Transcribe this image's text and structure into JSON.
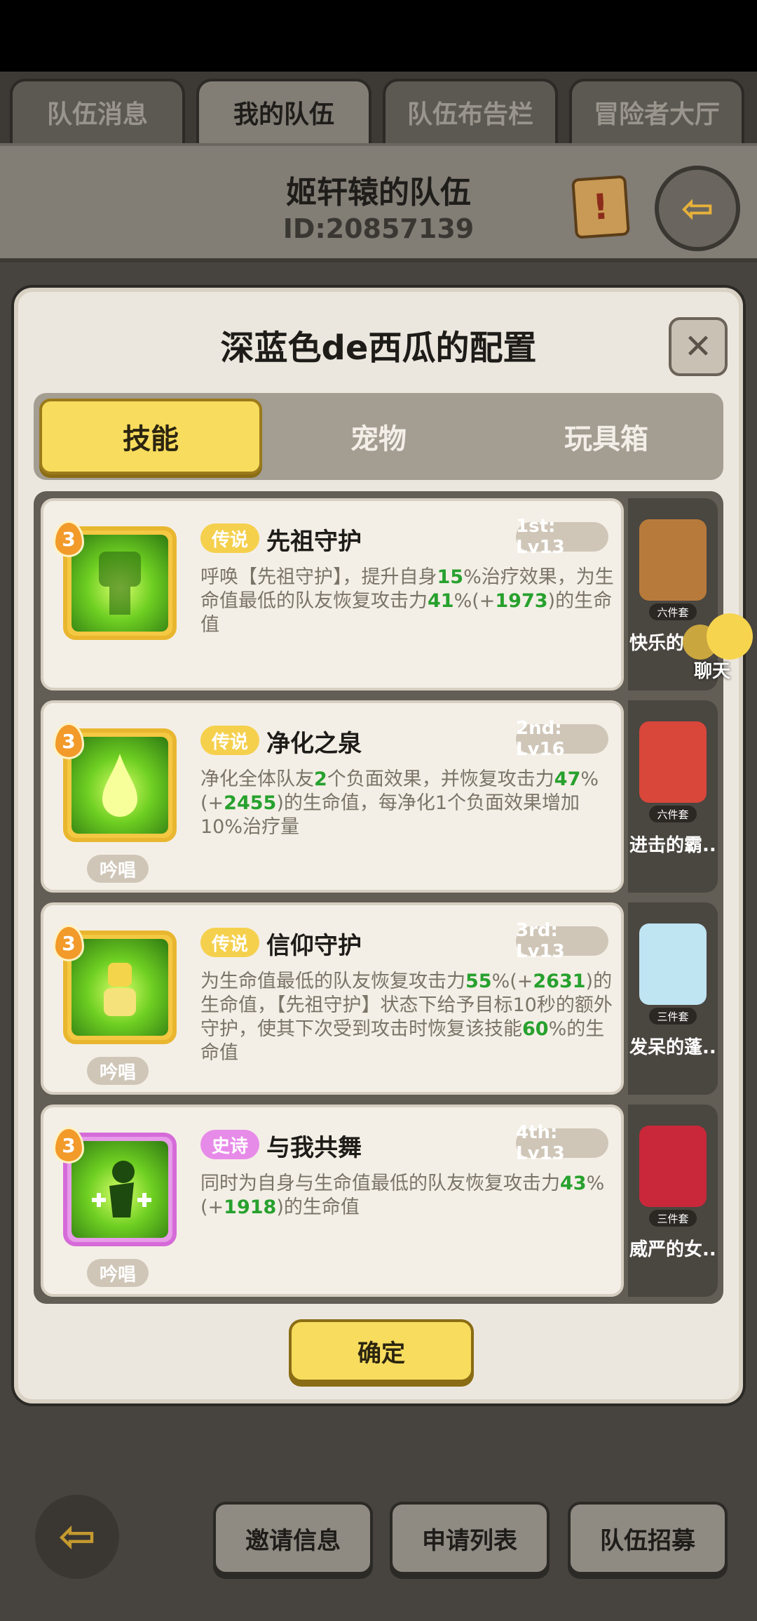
{
  "tabs": [
    "队伍消息",
    "我的队伍",
    "队伍布告栏",
    "冒险者大厅"
  ],
  "team": {
    "name": "姬轩辕的队伍",
    "id": "ID:20857139"
  },
  "dialog": {
    "title": "深蓝色de西瓜的配置",
    "segments": [
      "技能",
      "宠物",
      "玩具箱"
    ],
    "confirm": "确定",
    "close": "✕"
  },
  "skills": [
    {
      "level": "3",
      "rarity": "传说",
      "name": "先祖守护",
      "slot": "1st: Lv13",
      "chant": "",
      "desc": [
        {
          "t": "呼唤【先祖守护】，提升自身"
        },
        {
          "t": "15",
          "g": true
        },
        {
          "t": "%治疗效果，为生命值最低的队友恢复攻击力"
        },
        {
          "t": "41",
          "g": true
        },
        {
          "t": "%(+"
        },
        {
          "t": "1973",
          "g": true
        },
        {
          "t": ")的生命值"
        }
      ]
    },
    {
      "level": "3",
      "rarity": "传说",
      "name": "净化之泉",
      "slot": "2nd: Lv16",
      "chant": "吟唱",
      "desc": [
        {
          "t": "净化全体队友"
        },
        {
          "t": "2",
          "g": true
        },
        {
          "t": "个负面效果，并恢复攻击力"
        },
        {
          "t": "47",
          "g": true
        },
        {
          "t": "%(+"
        },
        {
          "t": "2455",
          "g": true
        },
        {
          "t": ")的生命值，每净化1个负面效果增加10%治疗量"
        }
      ]
    },
    {
      "level": "3",
      "rarity": "传说",
      "name": "信仰守护",
      "slot": "3rd: Lv13",
      "chant": "吟唱",
      "desc": [
        {
          "t": "为生命值最低的队友恢复攻击力"
        },
        {
          "t": "55",
          "g": true
        },
        {
          "t": "%(+"
        },
        {
          "t": "2631",
          "g": true
        },
        {
          "t": ")的生命值，【先祖守护】状态下给予目标10秒的额外守护，使其下次受到攻击时恢复该技能"
        },
        {
          "t": "60",
          "g": true
        },
        {
          "t": "%的生命值"
        }
      ]
    },
    {
      "level": "3",
      "rarity": "史诗",
      "name": "与我共舞",
      "slot": "4th: Lv13",
      "chant": "吟唱",
      "desc": [
        {
          "t": "同时为自身与生命值最低的队友恢复攻击力"
        },
        {
          "t": "43",
          "g": true
        },
        {
          "t": "%(+"
        },
        {
          "t": "1918",
          "g": true
        },
        {
          "t": ")的生命值"
        }
      ]
    }
  ],
  "pets": [
    {
      "set": "六件套",
      "name": "快乐的土",
      "color": "#b87a3a"
    },
    {
      "set": "六件套",
      "name": "进击的霸...",
      "color": "#d9463a"
    },
    {
      "set": "三件套",
      "name": "发呆的蓬...",
      "color": "#bfe4f2"
    },
    {
      "set": "三件套",
      "name": "威严的女...",
      "color": "#c9283a"
    }
  ],
  "chat": {
    "label": "聊天"
  },
  "bottom": {
    "back_icon": "⇦",
    "buttons": [
      "邀请信息",
      "申请列表",
      "队伍招募"
    ]
  },
  "colors": {
    "accent_yellow": "#f7dc5e",
    "value_green": "#27a12e",
    "epic_purple": "#e78be9"
  }
}
